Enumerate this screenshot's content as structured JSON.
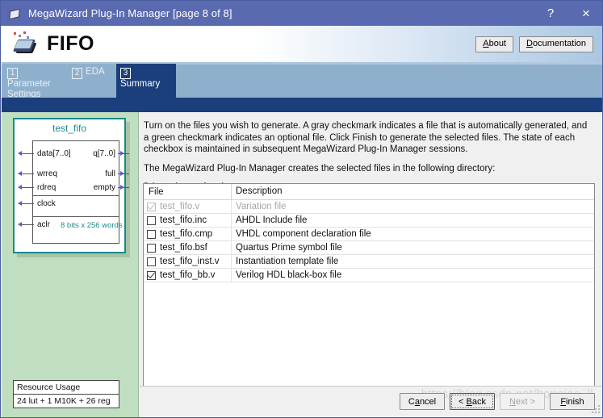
{
  "window": {
    "title": "MegaWizard Plug-In Manager [page 8 of 8]",
    "icon": "wizard-wand-icon",
    "help_label": "?",
    "close_label": "×"
  },
  "header": {
    "brand": "FIFO",
    "logo_icon": "altera-chip-icon",
    "buttons": [
      {
        "label_pre": "",
        "mnemonic": "A",
        "label_post": "bout",
        "name": "about-button"
      },
      {
        "label_pre": "",
        "mnemonic": "D",
        "label_post": "ocumentation",
        "name": "documentation-button"
      }
    ]
  },
  "tabs": [
    {
      "num": "1",
      "label": "Parameter Settings",
      "active": false
    },
    {
      "num": "2",
      "label": "EDA",
      "active": false
    },
    {
      "num": "3",
      "label": "Summary",
      "active": true
    }
  ],
  "left_panel": {
    "block": {
      "title": "test_fifo",
      "inputs": [
        "data[7..0]",
        "wrreq",
        "rdreq",
        "clock",
        "aclr"
      ],
      "outputs": [
        "q[7..0]",
        "full",
        "empty"
      ],
      "memory_note": "8 bits x 256 words"
    },
    "resource_usage": {
      "heading": "Resource Usage",
      "value": "24 lut + 1 M10K + 26 reg"
    }
  },
  "main": {
    "paragraph1": "Turn on the files you wish to generate. A gray checkmark indicates a file that is automatically generated, and a green checkmark indicates an optional file. Click Finish to generate the selected files. The state of each checkbox is maintained in subsequent MegaWizard Plug-In Manager sessions.",
    "paragraph2": "The MegaWizard Plug-In Manager creates the selected files in the following directory:",
    "directory": "D:\\temp\\test_altera\\",
    "table": {
      "columns": [
        "File",
        "Description"
      ],
      "rows": [
        {
          "checked": true,
          "disabled": true,
          "file": "test_fifo.v",
          "description": "Variation file"
        },
        {
          "checked": false,
          "disabled": false,
          "file": "test_fifo.inc",
          "description": "AHDL Include file"
        },
        {
          "checked": false,
          "disabled": false,
          "file": "test_fifo.cmp",
          "description": "VHDL component declaration file"
        },
        {
          "checked": false,
          "disabled": false,
          "file": "test_fifo.bsf",
          "description": "Quartus Prime symbol file"
        },
        {
          "checked": false,
          "disabled": false,
          "file": "test_fifo_inst.v",
          "description": "Instantiation template file"
        },
        {
          "checked": true,
          "disabled": false,
          "file": "test_fifo_bb.v",
          "description": "Verilog HDL black-box file"
        }
      ]
    }
  },
  "footer": {
    "watermark": "https://blog.csdn.net/hopeiao_ll",
    "buttons": [
      {
        "label_pre": "C",
        "mnemonic": "a",
        "label_post": "ncel",
        "name": "cancel-button",
        "state": "normal"
      },
      {
        "label_pre": "< ",
        "mnemonic": "B",
        "label_post": "ack",
        "name": "back-button",
        "state": "focus"
      },
      {
        "label_pre": "",
        "mnemonic": "N",
        "label_post": "ext >",
        "name": "next-button",
        "state": "disabled"
      },
      {
        "label_pre": "",
        "mnemonic": "F",
        "label_post": "inish",
        "name": "finish-button",
        "state": "normal"
      }
    ]
  },
  "colors": {
    "titlebar": "#5a6ab0",
    "tab_active": "#1b3f7c",
    "tab_inactive": "#8fb0cc",
    "left_panel": "#c0dfc0",
    "block_accent": "#1a8a8a"
  }
}
